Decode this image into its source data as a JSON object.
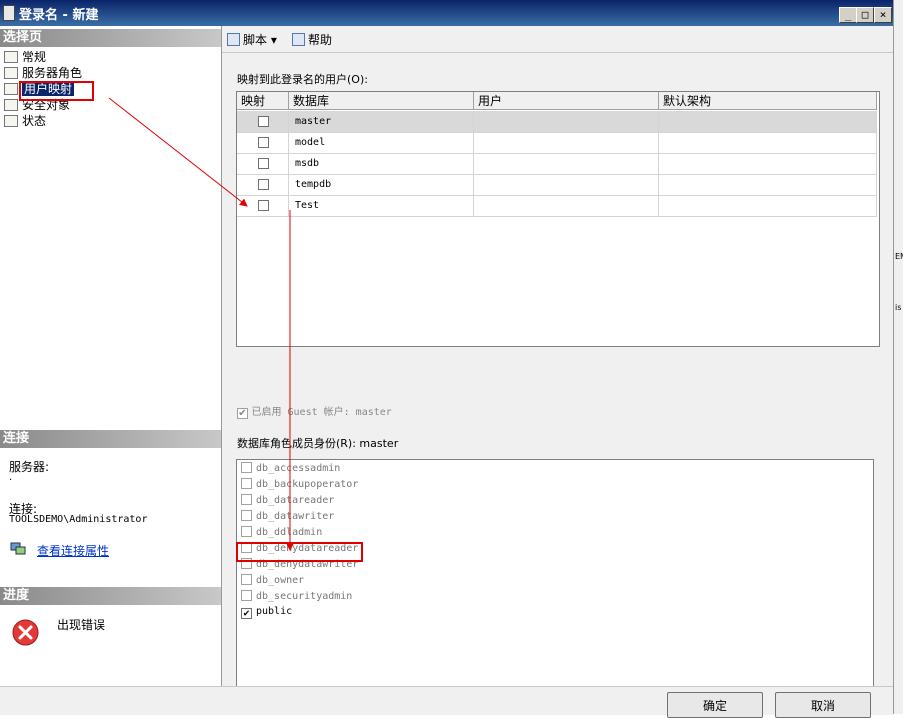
{
  "window": {
    "title": "登录名 - 新建",
    "min": "_",
    "max": "□",
    "close": "×"
  },
  "left": {
    "select_page_header": "选择页",
    "nav": [
      {
        "label": "常规"
      },
      {
        "label": "服务器角色"
      },
      {
        "label": "用户映射",
        "selected": true
      },
      {
        "label": "安全对象"
      },
      {
        "label": "状态"
      }
    ],
    "connection_header": "连接",
    "server_label": "服务器:",
    "server_value": ".",
    "connection_label": "连接:",
    "connection_value": "TOOLSDEMO\\Administrator",
    "view_props_link": "查看连接属性",
    "progress_header": "进度",
    "progress_status": "出现错误"
  },
  "toolbar": {
    "script_label": "脚本",
    "script_arrow": "▾",
    "help_label": "帮助"
  },
  "mapping": {
    "label": "映射到此登录名的用户(O):",
    "columns": [
      "映射",
      "数据库",
      "用户",
      "默认架构"
    ],
    "rows": [
      {
        "db": "master",
        "checked": false,
        "user": "",
        "schema": ""
      },
      {
        "db": "model",
        "checked": false,
        "user": "",
        "schema": ""
      },
      {
        "db": "msdb",
        "checked": false,
        "user": "",
        "schema": ""
      },
      {
        "db": "tempdb",
        "checked": false,
        "user": "",
        "schema": ""
      },
      {
        "db": "Test",
        "checked": false,
        "user": "",
        "schema": ""
      }
    ]
  },
  "guest": {
    "label": "已启用 Guest 帐户: master",
    "checked": true
  },
  "roles": {
    "label": "数据库角色成员身份(R): master",
    "items": [
      {
        "name": "db_accessadmin",
        "checked": false
      },
      {
        "name": "db_backupoperator",
        "checked": false
      },
      {
        "name": "db_datareader",
        "checked": false
      },
      {
        "name": "db_datawriter",
        "checked": false
      },
      {
        "name": "db_ddladmin",
        "checked": false
      },
      {
        "name": "db_denydatareader",
        "checked": false
      },
      {
        "name": "db_denydatawriter",
        "checked": false
      },
      {
        "name": "db_owner",
        "checked": false
      },
      {
        "name": "db_securityadmin",
        "checked": false
      },
      {
        "name": "public",
        "checked": true
      }
    ]
  },
  "buttons": {
    "ok": "确定",
    "cancel": "取消"
  },
  "annotation_color": "#e00000",
  "right_edge_text": [
    "EM",
    "is"
  ]
}
